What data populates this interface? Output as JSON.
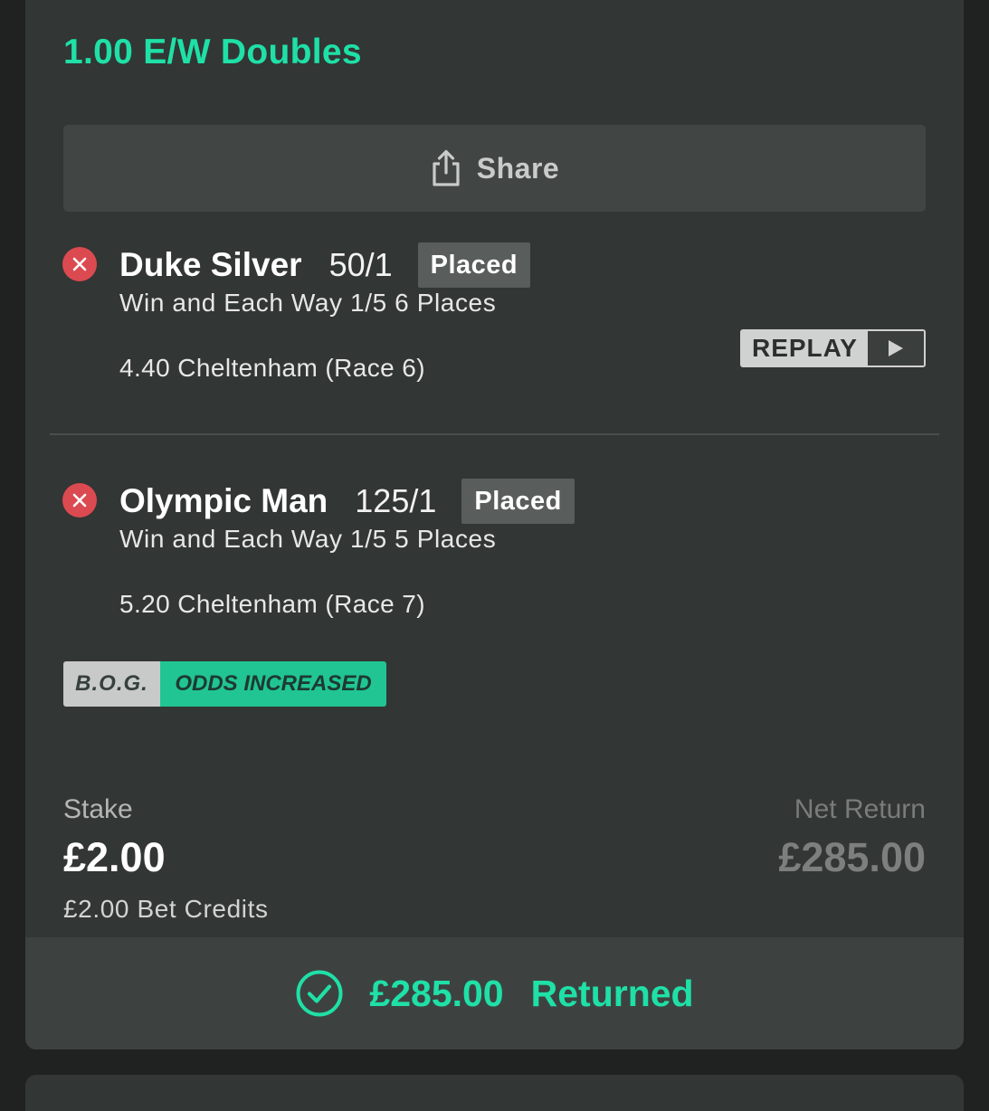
{
  "bet": {
    "title": "1.00 E/W Doubles",
    "share_label": "Share"
  },
  "selections": [
    {
      "horse": "Duke Silver",
      "odds": "50/1",
      "result": "Placed",
      "market": "Win and Each Way 1/5 6 Places",
      "race": "4.40 Cheltenham (Race 6)",
      "replay_label": "REPLAY"
    },
    {
      "horse": "Olympic Man",
      "odds": "125/1",
      "result": "Placed",
      "market": "Win and Each Way 1/5 5 Places",
      "race": "5.20 Cheltenham (Race 7)"
    }
  ],
  "bog": {
    "left": "B.O.G.",
    "right": "ODDS INCREASED"
  },
  "summary": {
    "stake_label": "Stake",
    "stake_value": "£2.00",
    "bet_credits": "£2.00 Bet Credits",
    "net_return_label": "Net Return",
    "net_return_value": "£285.00"
  },
  "returned": {
    "amount": "£285.00",
    "label": "Returned"
  },
  "colors": {
    "accent": "#1fe0a7",
    "lost_icon": "#dc4a51",
    "card_bg": "#323634",
    "page_bg": "#202221"
  },
  "icons": {
    "share": "share-icon",
    "lost": "close-circle-icon",
    "play": "play-icon",
    "returned": "check-circle-icon"
  }
}
